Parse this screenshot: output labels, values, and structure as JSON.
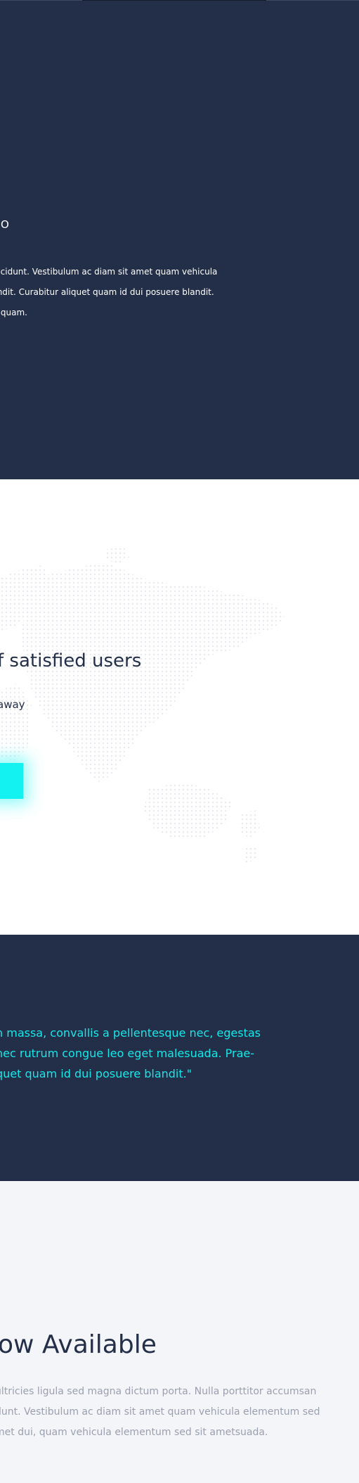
{
  "colors": {
    "dark_bg": "#232e48",
    "white_bg": "#ffffff",
    "light_bg": "#f4f5f8",
    "accent_cyan": "#14f1f1",
    "muted_text": "#9aa0b0",
    "map_dot": "#e9ebf0"
  },
  "video_section": {
    "label": "DEO",
    "desc_lines": [
      "tincidunt. Vestibulum ac diam sit amet quam vehicula",
      "landit. Curabitur aliquet quam id dui posuere blandit.",
      "et quam."
    ]
  },
  "users_section": {
    "title": "f satisfied users",
    "subtitle": "away",
    "map_icon": "world-map-dots",
    "button_label": ""
  },
  "quote_section": {
    "lines": [
      "n massa, convallis a pellentesque nec, egestas",
      "nec rutrum congue leo eget malesuada. Prae-",
      "quet quam id dui posuere blandit.\""
    ]
  },
  "available_section": {
    "title": "ow Available",
    "desc_lines": [
      "ultricies ligula sed magna dictum porta. Nulla porttitor accumsan",
      "dunt. Vestibulum ac diam sit amet quam vehicula elementum sed",
      "met dui, quam vehicula elementum sed sit ametsuada."
    ]
  }
}
